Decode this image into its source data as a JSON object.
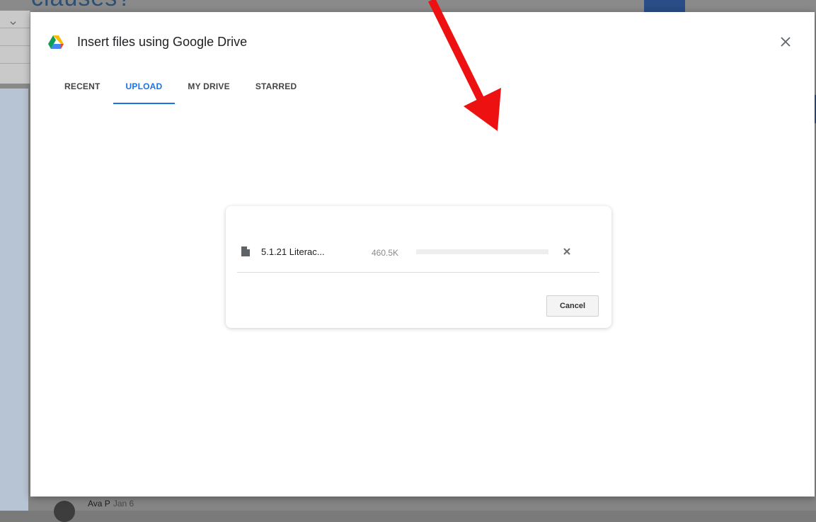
{
  "background": {
    "heading_fragment": "clauses?",
    "author": "Ava P",
    "date": "Jan 6"
  },
  "dialog": {
    "title": "Insert files using Google Drive",
    "tabs": [
      {
        "label": "RECENT",
        "active": false
      },
      {
        "label": "UPLOAD",
        "active": true
      },
      {
        "label": "MY DRIVE",
        "active": false
      },
      {
        "label": "STARRED",
        "active": false
      }
    ]
  },
  "upload": {
    "file_name": "5.1.21 Literac...",
    "file_size": "460.5K",
    "progress_percent": 0,
    "cancel_label": "Cancel"
  },
  "icons": {
    "drive": "google-drive-icon",
    "close": "close-icon",
    "file": "file-icon",
    "remove": "remove-icon"
  },
  "colors": {
    "accent": "#1a73e8",
    "annotation_arrow": "#ee1111"
  }
}
